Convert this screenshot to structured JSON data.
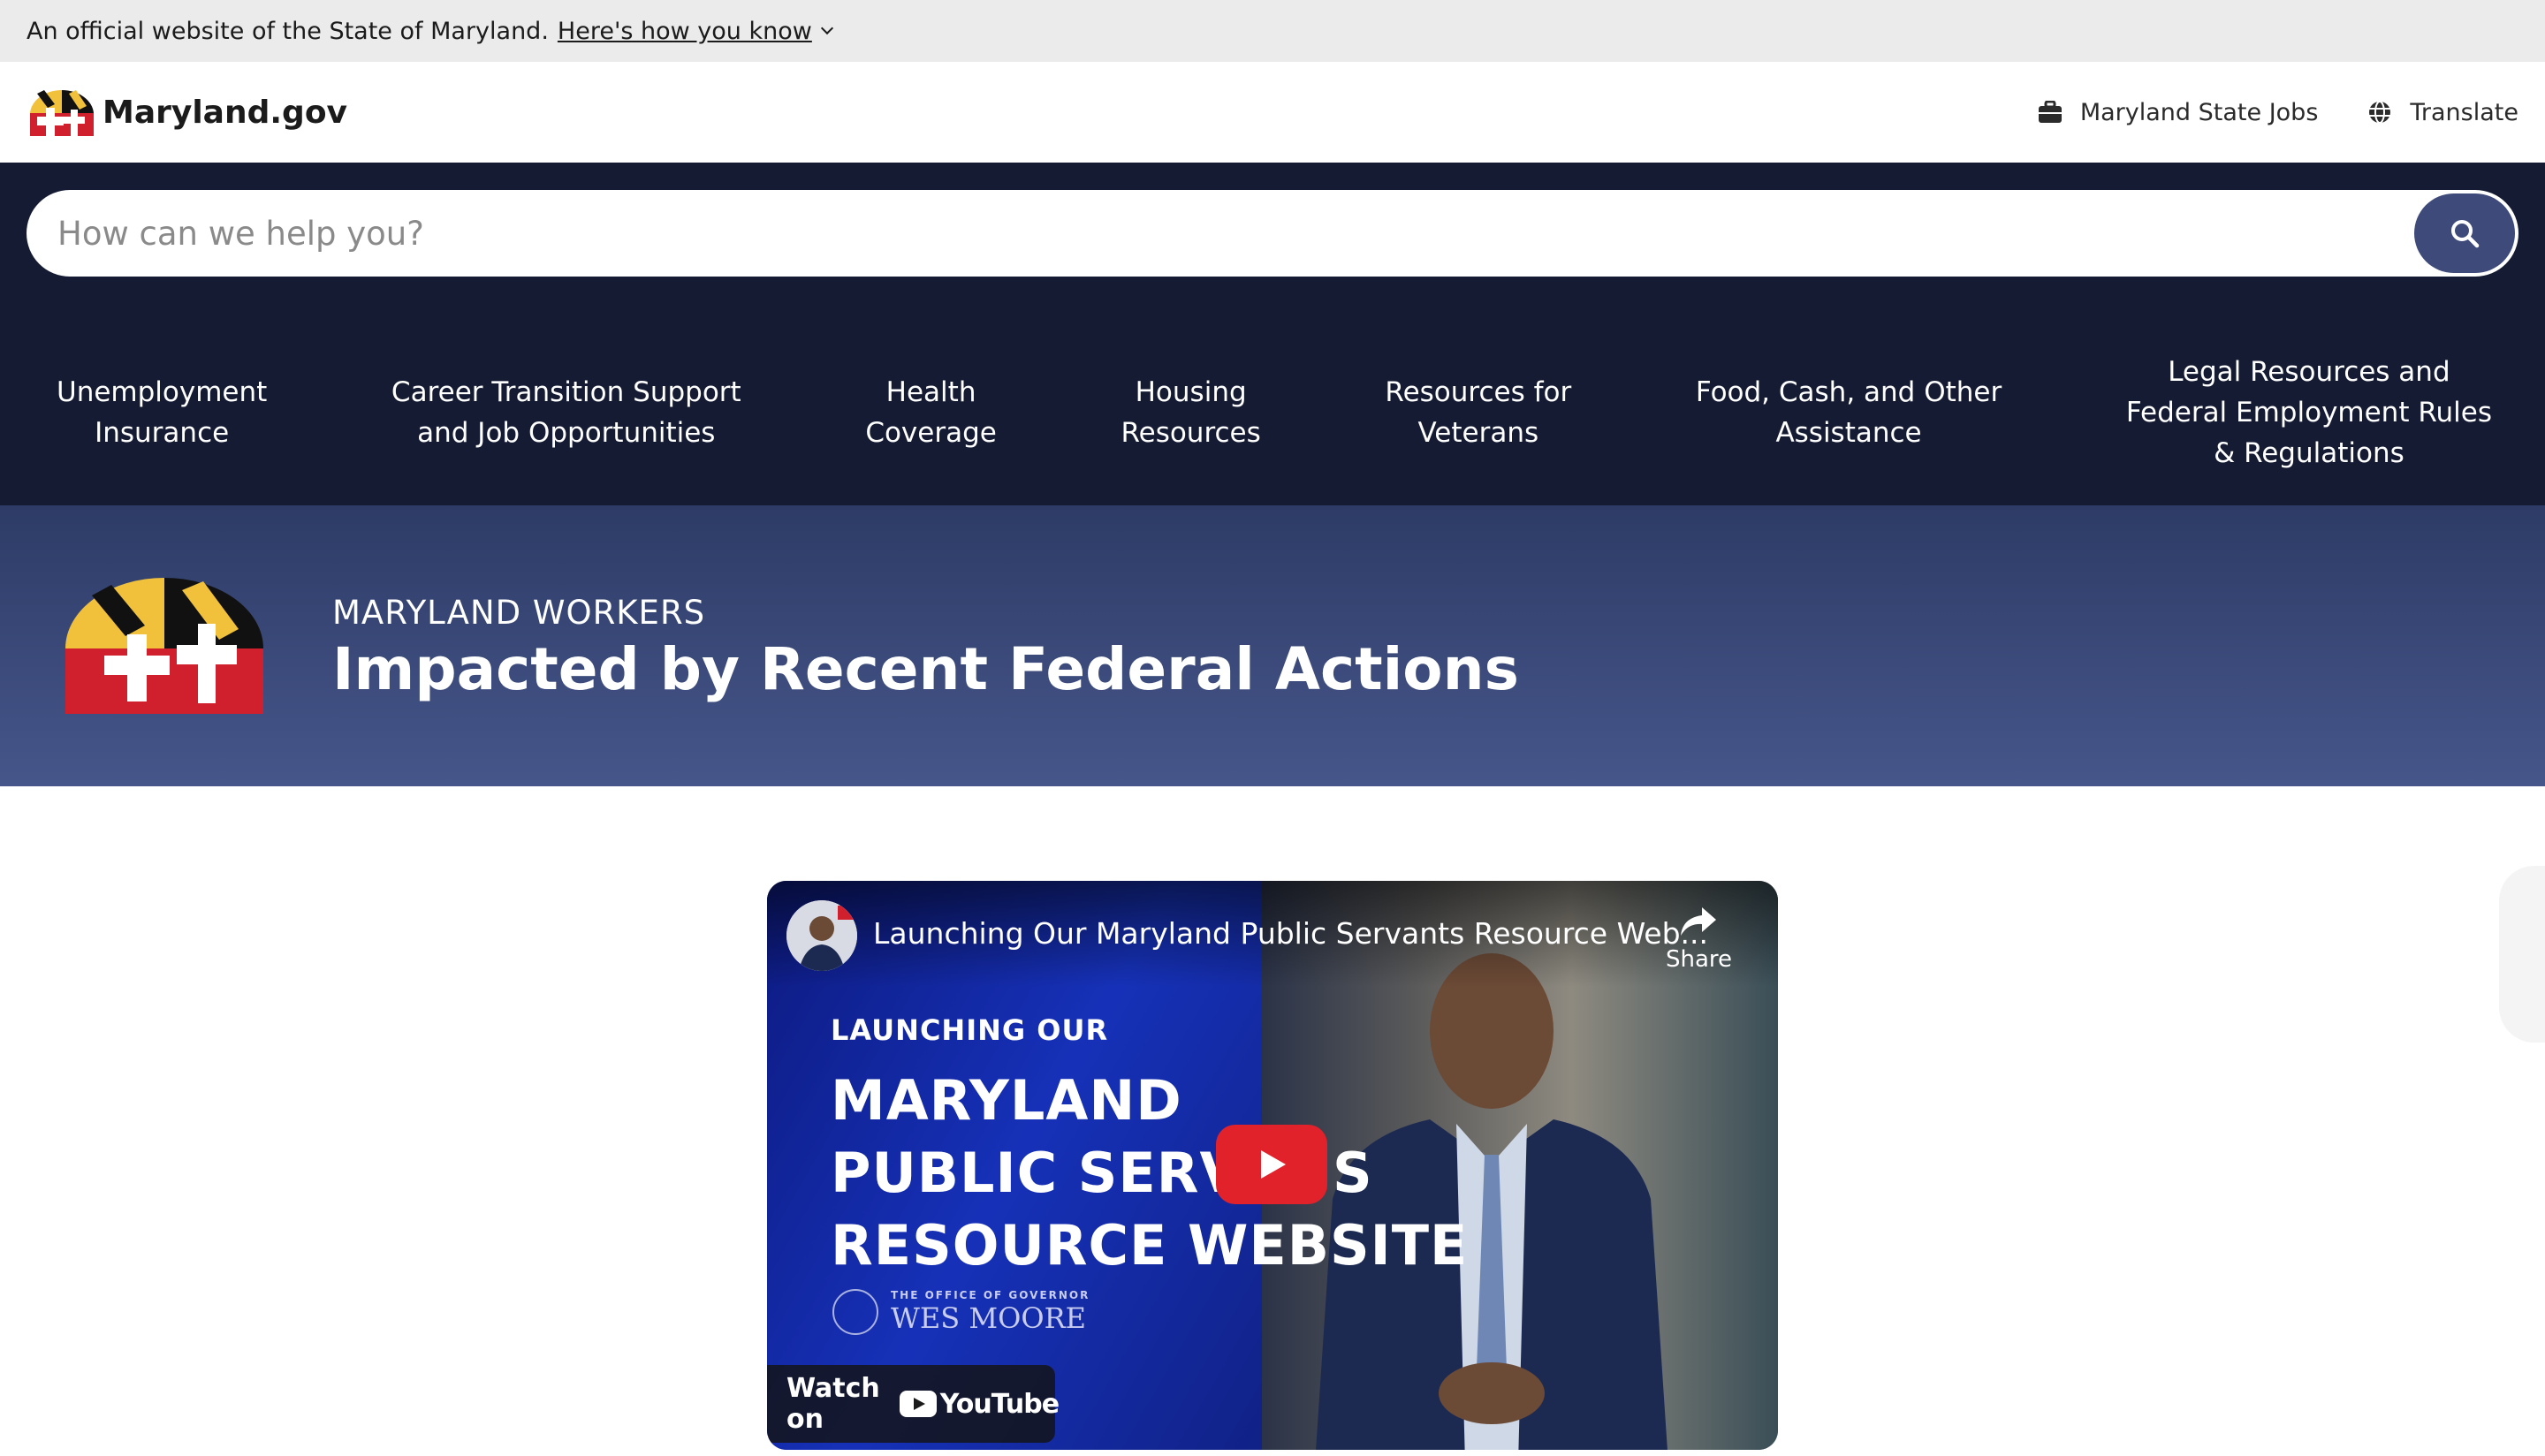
{
  "banner": {
    "text": "An official website of the State of Maryland.",
    "link": "Here's how you know"
  },
  "header": {
    "brand": "Maryland.gov",
    "links": [
      {
        "label": "Maryland State Jobs",
        "icon": "briefcase-icon"
      },
      {
        "label": "Translate",
        "icon": "globe-icon"
      }
    ]
  },
  "search": {
    "placeholder": "How can we help you?",
    "button_icon": "search-icon"
  },
  "topics": [
    "Unemployment\nInsurance",
    "Career Transition Support\nand Job Opportunities",
    "Health\nCoverage",
    "Housing\nResources",
    "Resources for\nVeterans",
    "Food, Cash, and Other\nAssistance",
    "Legal Resources and\nFederal Employment Rules\n& Regulations"
  ],
  "hero": {
    "kicker": "MARYLAND WORKERS",
    "title": "Impacted by Recent Federal Actions"
  },
  "video": {
    "title": "Launching Our Maryland Public Servants Resource Web...",
    "share": "Share",
    "overlay_small": "LAUNCHING OUR",
    "overlay_lines": [
      "MARYLAND",
      "PUBLIC SERV",
      "S",
      "RESOURCE WEBSITE"
    ],
    "seal_small": "THE OFFICE OF GOVERNOR",
    "seal_name": "WES MOORE",
    "watch_on": "Watch on",
    "platform": "YouTube"
  },
  "colors": {
    "nav_bg": "#141b33",
    "hero_bg": "#3a4a7a",
    "search_button": "#3d4a7a",
    "play_button": "#e1222b"
  }
}
